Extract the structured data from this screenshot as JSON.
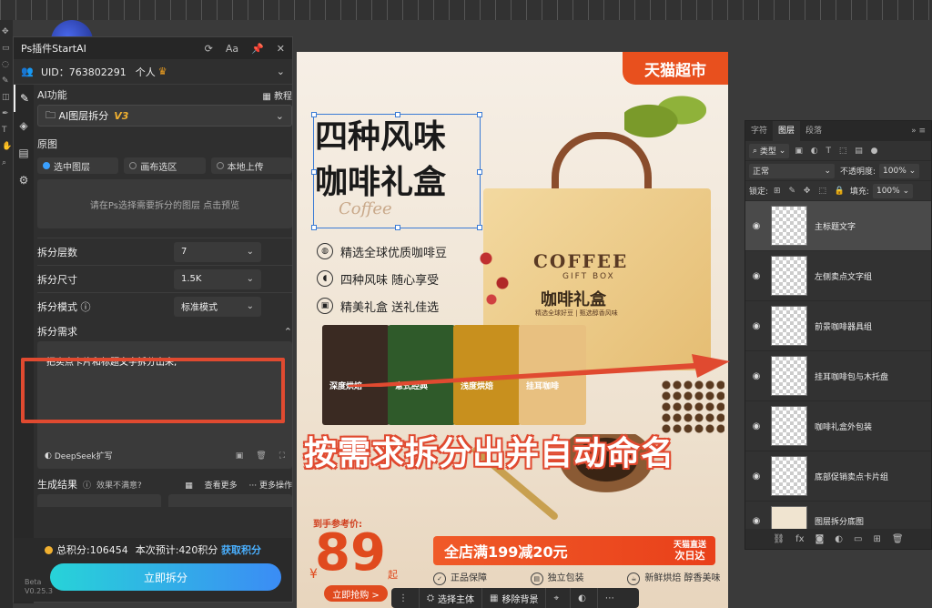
{
  "plugin": {
    "title": "Ps插件StartAI",
    "title_controls": [
      "⟳",
      "Aa",
      "📌",
      "✕"
    ],
    "uid": "UID：763802291",
    "tier": "个人",
    "ai_label": "AI功能",
    "tutorial": "教程",
    "ai_function": "AI图层拆分",
    "ai_version": "V3",
    "source_label": "原图",
    "source_options": [
      "选中图层",
      "画布选区",
      "本地上传"
    ],
    "source_selected": "选中图层",
    "preview_hint": "请在Ps选择需要拆分的图层 点击预览",
    "params": [
      {
        "label": "拆分层数",
        "value": "7"
      },
      {
        "label": "拆分尺寸",
        "value": "1.5K"
      },
      {
        "label": "拆分模式 ⓘ",
        "value": "标准模式"
      }
    ],
    "req_label": "拆分需求",
    "req_text": "把卖点卡片和标题文字拆分出来,",
    "deepseek": "DeepSeek扩写",
    "result_label": "生成结果",
    "result_hint": "效果不满意?",
    "view_more": "查看更多",
    "more_ops": "··· 更多操作",
    "points_total": "总积分:106454",
    "points_est": "本次预计:420积分",
    "get_points": "获取积分",
    "split_button": "立即拆分",
    "beta": "Beta",
    "version": "V0.25.3"
  },
  "poster": {
    "badge": "天猫超市",
    "headline_1": "四种风味",
    "headline_2": "咖啡礼盒",
    "script": "Coffee",
    "features": [
      "精选全球优质咖啡豆",
      "四种风味 随心享受",
      "精美礼盒 送礼佳选"
    ],
    "box_title": "COFFEE",
    "box_sub": "GIFT BOX",
    "box_cn": "咖啡礼盒",
    "box_tiny": "精选全球好豆 | 甄选醇香风味",
    "packs": [
      "深度烘焙",
      "意式经典",
      "浅度烘焙",
      "挂耳咖啡"
    ],
    "caption": "按需求拆分出并自动命名",
    "price_ref": "到手参考价:",
    "price": "89",
    "price_cur": "¥",
    "price_qi": "起",
    "buy": "立即抢购 >",
    "promo": "全店满199减20元",
    "ship_top": "天猫直送",
    "ship_bottom": "次日达",
    "bottom_feats": [
      "正品保障",
      "独立包装",
      "新鲜烘焙 醇香美味"
    ]
  },
  "float_toolbar": {
    "select_subject": "选择主体",
    "remove_bg": "移除背景"
  },
  "layers": {
    "tabs": [
      "字符",
      "图层",
      "段落"
    ],
    "active_tab": "图层",
    "filter": "类型",
    "blend": "正常",
    "opacity_label": "不透明度:",
    "opacity": "100%",
    "lock_label": "锁定:",
    "fill_label": "填充:",
    "fill": "100%",
    "items": [
      {
        "name": "主标题文字",
        "selected": true
      },
      {
        "name": "左侧卖点文字组",
        "selected": false
      },
      {
        "name": "前景咖啡器具组",
        "selected": false
      },
      {
        "name": "挂耳咖啡包与木托盘",
        "selected": false
      },
      {
        "name": "咖啡礼盒外包装",
        "selected": false
      },
      {
        "name": "底部促销卖点卡片组",
        "selected": false
      },
      {
        "name": "图层拆分底图",
        "selected": false
      }
    ]
  },
  "colors": {
    "accent": "#e04a30",
    "tmall": "#e8501e",
    "button_start": "#27d3d8",
    "button_end": "#3b8cf5"
  }
}
